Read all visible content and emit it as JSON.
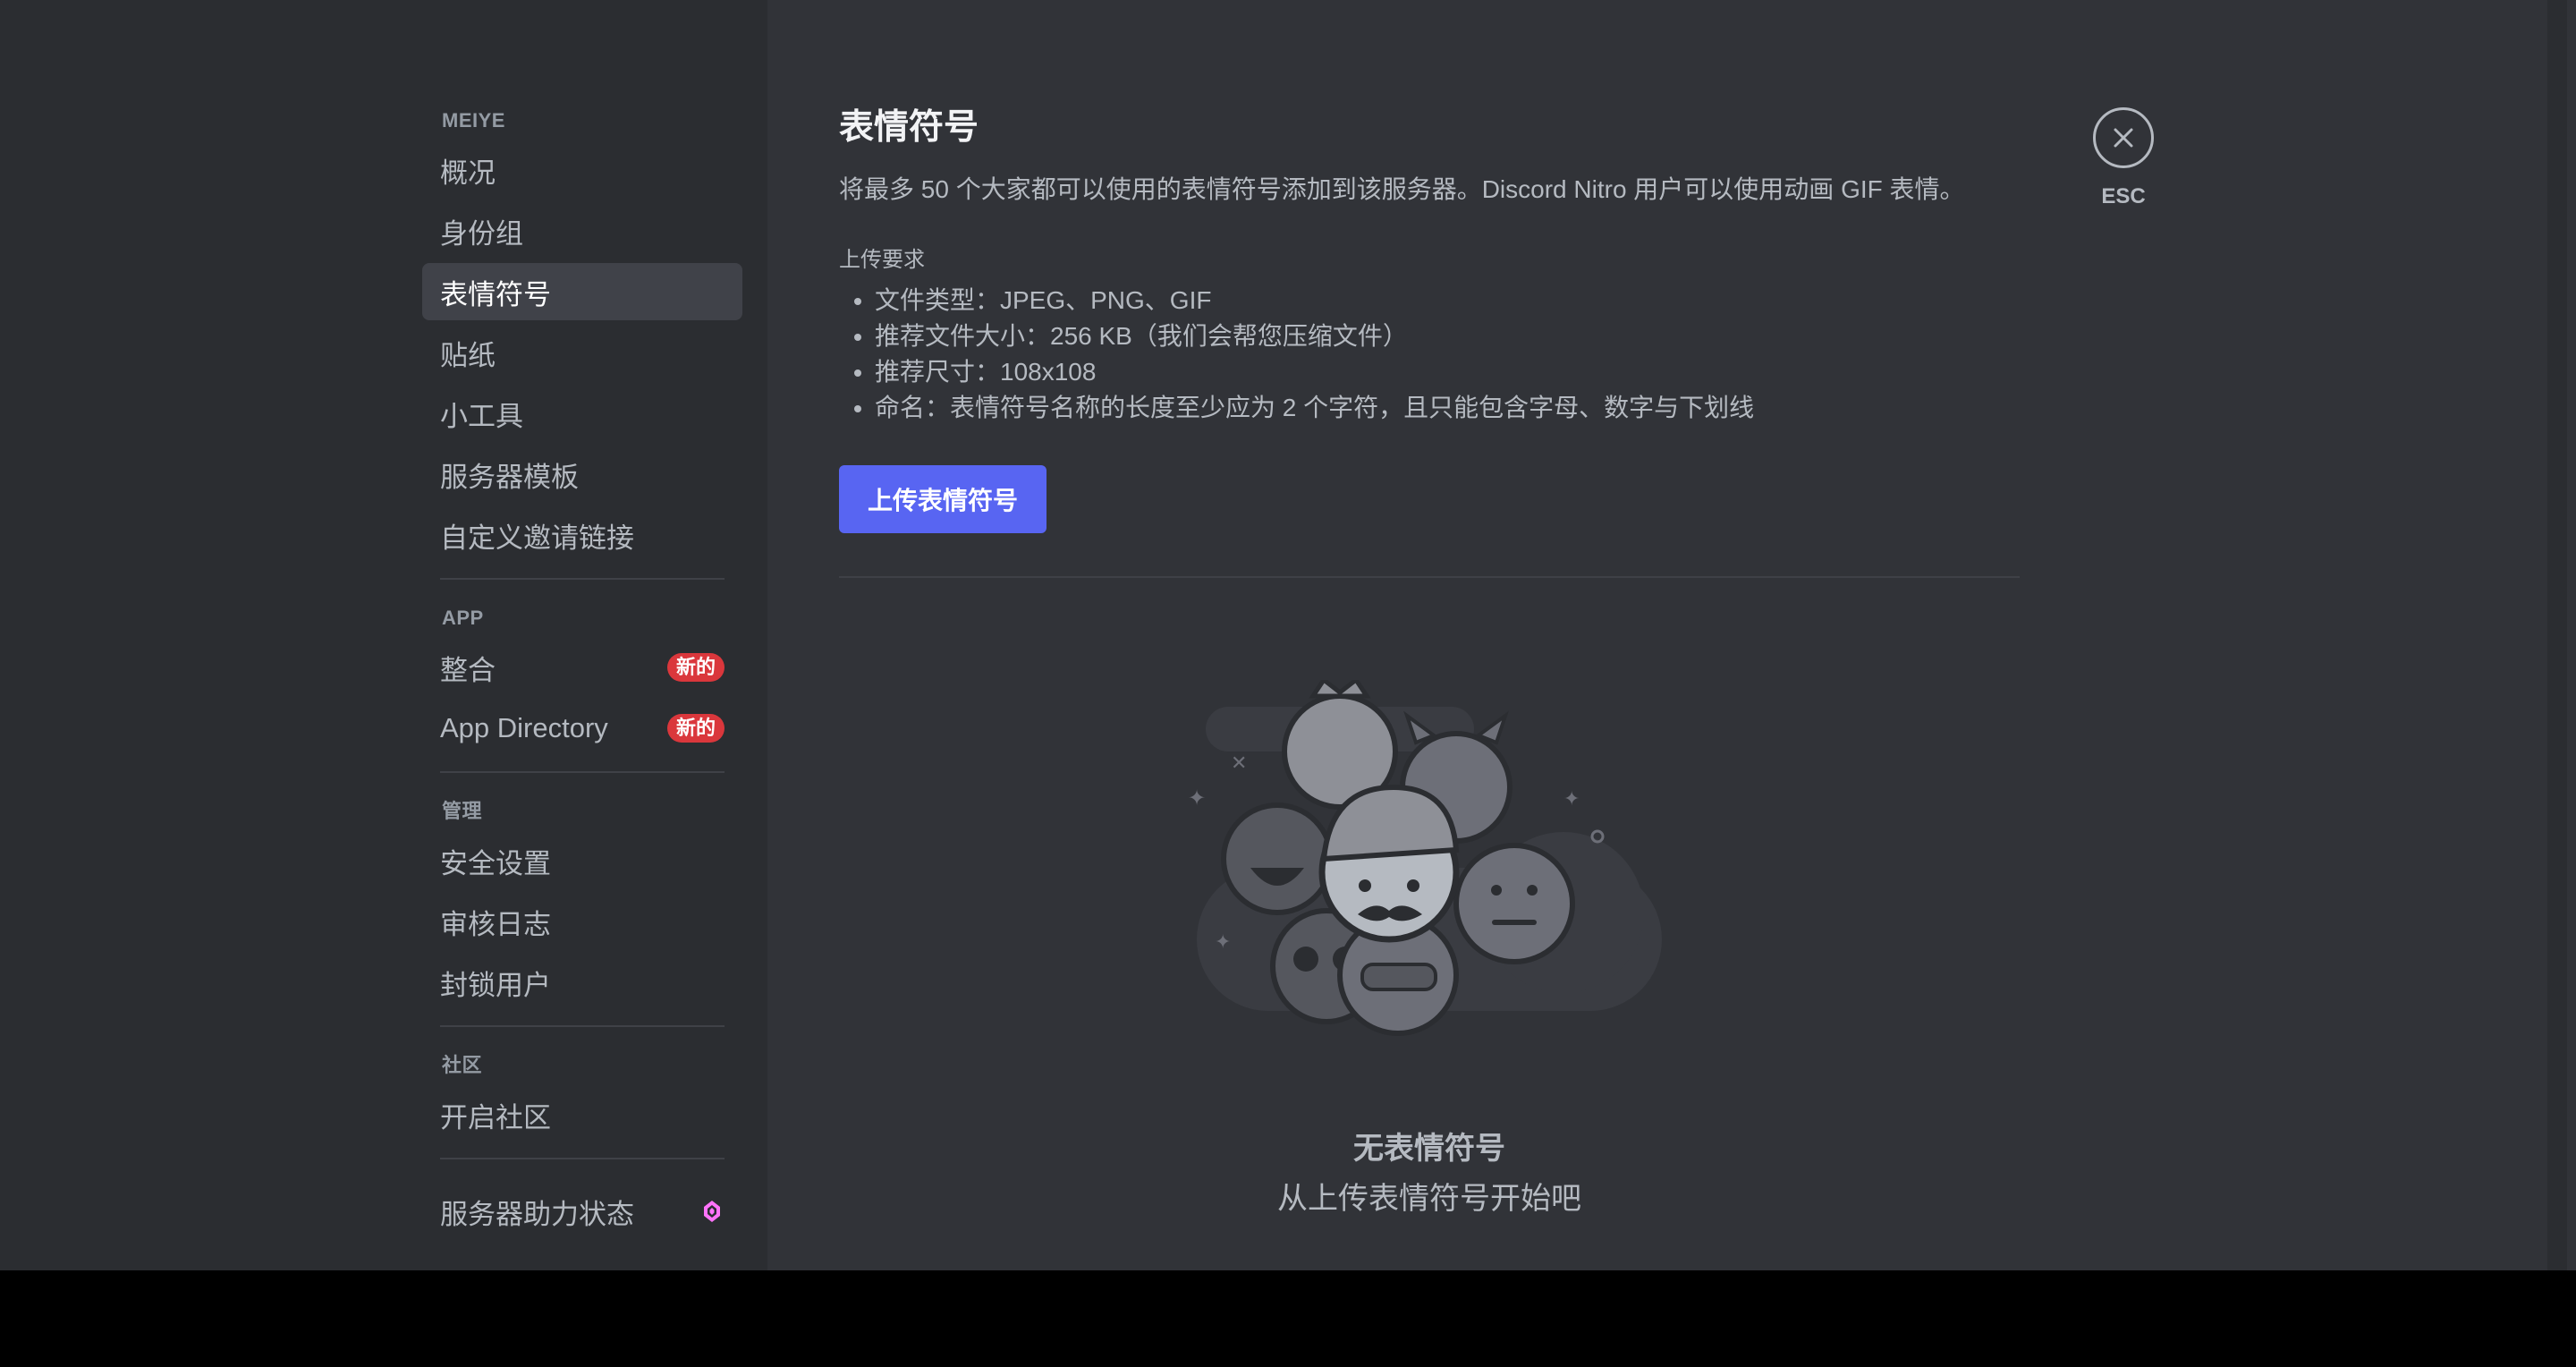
{
  "sidebar": {
    "server_section": {
      "header": "MEIYE",
      "items": [
        {
          "label": "概况"
        },
        {
          "label": "身份组"
        },
        {
          "label": "表情符号",
          "active": true
        },
        {
          "label": "贴纸"
        },
        {
          "label": "小工具"
        },
        {
          "label": "服务器模板"
        },
        {
          "label": "自定义邀请链接"
        }
      ]
    },
    "app_section": {
      "header": "APP",
      "items": [
        {
          "label": "整合",
          "badge": "新的"
        },
        {
          "label": "App Directory",
          "badge": "新的"
        }
      ]
    },
    "manage_section": {
      "header": "管理",
      "items": [
        {
          "label": "安全设置"
        },
        {
          "label": "审核日志"
        },
        {
          "label": "封锁用户"
        }
      ]
    },
    "community_section": {
      "header": "社区",
      "items": [
        {
          "label": "开启社区"
        }
      ]
    },
    "boost": {
      "label": "服务器助力状态",
      "icon": "boost-gem-icon",
      "icon_color": "#ff73fa"
    }
  },
  "main": {
    "title": "表情符号",
    "description": "将最多 50 个大家都可以使用的表情符号添加到该服务器。Discord Nitro 用户可以使用动画 GIF 表情。",
    "requirements_title": "上传要求",
    "requirements": [
      "文件类型：JPEG、PNG、GIF",
      "推荐文件大小：256 KB（我们会帮您压缩文件）",
      "推荐尺寸：108x108",
      "命名：表情符号名称的长度至少应为 2 个字符，且只能包含字母、数字与下划线"
    ],
    "upload_button": "上传表情符号",
    "empty_title": "无表情符号",
    "empty_subtitle": "从上传表情符号开始吧"
  },
  "close": {
    "icon": "close-icon",
    "label": "ESC"
  },
  "colors": {
    "accent": "#5865f2",
    "badge": "#da373c",
    "sidebar_bg": "#2b2d31",
    "content_bg": "#313338"
  }
}
